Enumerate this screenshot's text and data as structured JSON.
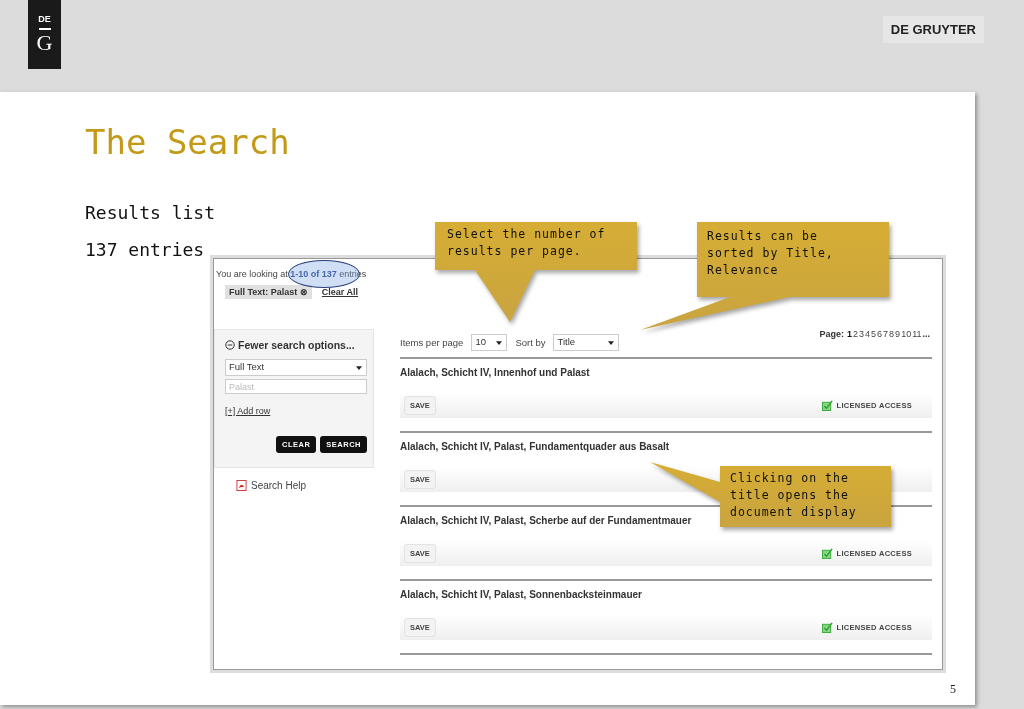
{
  "logo": {
    "top": "DE",
    "bottom": "G"
  },
  "brand": "DE GRUYTER",
  "slide": {
    "title": "The Search",
    "lines": [
      "Results list",
      "137 entries"
    ],
    "page_number": "5"
  },
  "screenshot": {
    "summary": {
      "prefix": "You are looking at ",
      "range": "1-10 of 137",
      "suffix": " entries"
    },
    "filter": {
      "chip": "Full Text: Palast",
      "remove": "⊗",
      "clear": "Clear All"
    },
    "sidebar": {
      "heading": "Fewer search options...",
      "field_select": "Full Text",
      "query_placeholder": "Palast",
      "add_row": "[+] Add row",
      "buttons": [
        "CLEAR",
        "SEARCH"
      ],
      "help": "Search Help"
    },
    "toolbar": {
      "items_label": "Items per page",
      "items_value": "10",
      "sort_label": "Sort by",
      "sort_value": "Title",
      "page_label": "Page:",
      "pages": [
        {
          "label": "1",
          "selected": true
        },
        {
          "label": "2",
          "selected": false
        },
        {
          "label": "3",
          "selected": false
        },
        {
          "label": "4",
          "selected": false
        },
        {
          "label": "5",
          "selected": false
        },
        {
          "label": "6",
          "selected": false
        },
        {
          "label": "7",
          "selected": false
        },
        {
          "label": "8",
          "selected": false
        },
        {
          "label": "9",
          "selected": false
        },
        {
          "label": "10",
          "selected": false
        },
        {
          "label": "11",
          "selected": false
        }
      ],
      "more": "..."
    },
    "results": [
      {
        "title": "Alalach, Schicht IV, Innenhof und Palast",
        "save": "SAVE",
        "access": "LICENSED ACCESS"
      },
      {
        "title": "Alalach, Schicht IV, Palast, Fundamentquader aus Basalt",
        "save": "SAVE"
      },
      {
        "title": "Alalach, Schicht IV, Palast, Scherbe auf der Fundamentmauer",
        "save": "SAVE",
        "access": "LICENSED ACCESS"
      },
      {
        "title": "Alalach, Schicht IV, Palast, Sonnenbacksteinmauer",
        "save": "SAVE",
        "access": "LICENSED ACCESS"
      }
    ]
  },
  "callouts": [
    {
      "text": "Select the number of results per page."
    },
    {
      "text": "Results can be sorted by Title, Relevance"
    },
    {
      "text": "Clicking on the title opens the document display"
    }
  ]
}
